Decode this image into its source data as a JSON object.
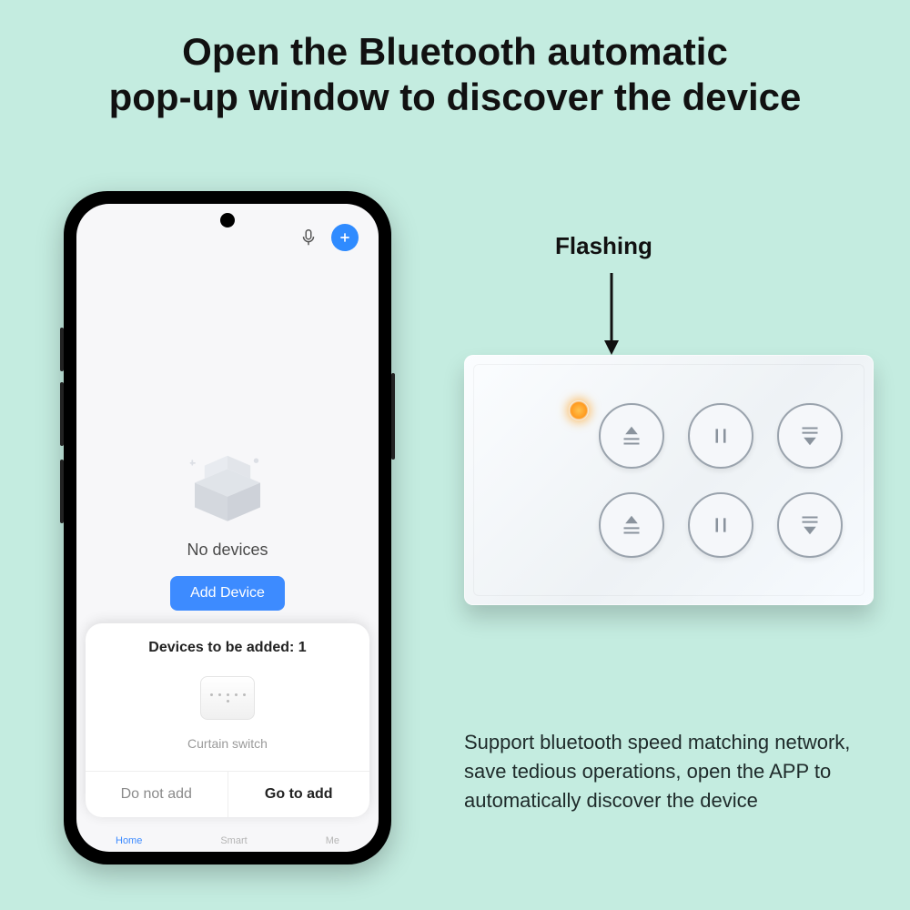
{
  "headline": "Open the Bluetooth automatic\npop-up window to discover the device",
  "phone": {
    "no_devices": "No devices",
    "add_device": "Add Device",
    "popup_title": "Devices to be added: 1",
    "device_name": "Curtain switch",
    "do_not_add": "Do not add",
    "go_to_add": "Go to add",
    "nav": {
      "home": "Home",
      "smart": "Smart",
      "me": "Me"
    }
  },
  "flashing_label": "Flashing",
  "description": "Support bluetooth speed matching network, save tedious operations, open the APP to automatically discover the device"
}
